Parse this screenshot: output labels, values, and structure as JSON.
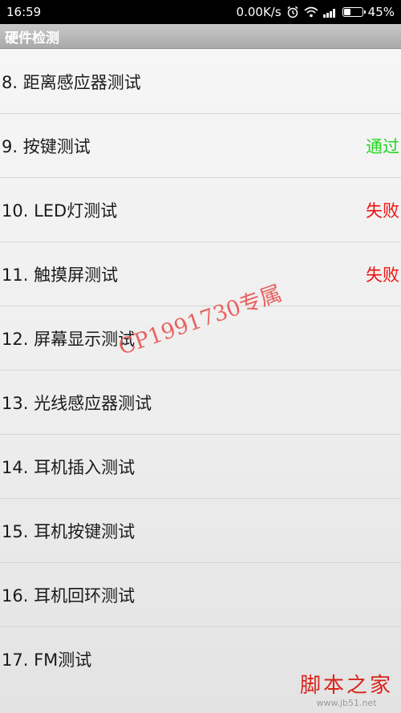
{
  "status_bar": {
    "time": "16:59",
    "net_speed": "0.00K/s",
    "battery": "45%",
    "battery_level": 0.45,
    "icons": [
      "alarm-icon",
      "wifi-icon",
      "signal-icon",
      "battery-icon"
    ]
  },
  "title_bar": {
    "title": "硬件检测"
  },
  "tests": [
    {
      "label": "8. 距离感应器测试",
      "result": ""
    },
    {
      "label": "9. 按键测试",
      "result": "通过",
      "result_color": "#22d622"
    },
    {
      "label": "10. LED灯测试",
      "result": "失败",
      "result_color": "#ee1111"
    },
    {
      "label": "11. 触摸屏测试",
      "result": "失败",
      "result_color": "#ee1111"
    },
    {
      "label": "12. 屏幕显示测试",
      "result": ""
    },
    {
      "label": "13. 光线感应器测试",
      "result": ""
    },
    {
      "label": "14. 耳机插入测试",
      "result": ""
    },
    {
      "label": "15. 耳机按键测试",
      "result": ""
    },
    {
      "label": "16. 耳机回环测试",
      "result": ""
    },
    {
      "label": "17. FM测试",
      "result": ""
    }
  ],
  "watermark": "CP1991730专属",
  "site_logo": {
    "name": "脚本之家",
    "url": "www.jb51.net"
  }
}
